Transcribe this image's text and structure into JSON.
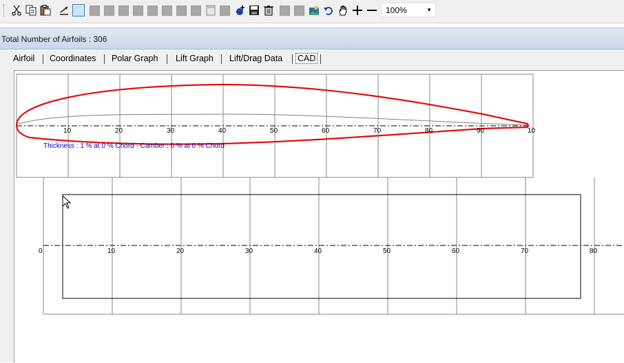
{
  "toolbar": {
    "zoom_value": "100%",
    "icons": [
      "cut-icon",
      "copy-icon",
      "paste-icon",
      "draw-line-icon",
      "select-rect-icon",
      "blank",
      "blank",
      "blank",
      "blank",
      "blank",
      "blank",
      "blank",
      "blank",
      "page-icon",
      "blank",
      "add-point-icon",
      "save-icon",
      "delete-icon",
      "blank",
      "blank",
      "image-icon",
      "undo-icon",
      "hand-pan-icon",
      "zoom-in-icon",
      "zoom-out-icon"
    ]
  },
  "status": {
    "total_airfoils": "Total Number of Airfoils : 306"
  },
  "tabs": [
    "Airfoil",
    "Coordinates",
    "Polar Graph",
    "Lift Graph",
    "Lift/Drag Data",
    "CAD"
  ],
  "active_tab": "CAD",
  "airfoil_view": {
    "axis_ticks": [
      "10",
      "20",
      "30",
      "40",
      "50",
      "60",
      "70",
      "80",
      "90",
      "10"
    ],
    "info_text": "Thickness : 1 % at 0 % Chord - Camber : 0 % at 0 % Chord",
    "colors": {
      "profile": "#e01010",
      "camber": "#808080",
      "info": "#0000c0"
    }
  },
  "wing_view": {
    "axis_ticks": [
      "0",
      "10",
      "20",
      "30",
      "40",
      "50",
      "60",
      "70",
      "80"
    ]
  }
}
